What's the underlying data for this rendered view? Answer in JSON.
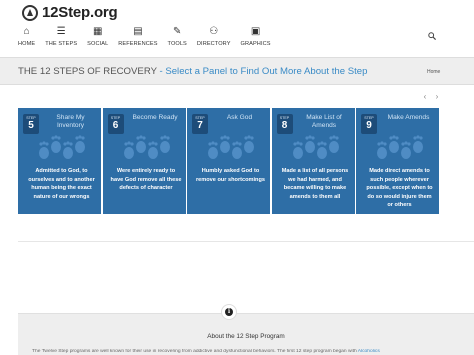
{
  "logo": {
    "text": "12Step.org"
  },
  "nav": [
    {
      "label": "HOME",
      "icon": "⌂"
    },
    {
      "label": "THE STEPS",
      "icon": "☰"
    },
    {
      "label": "SOCIAL",
      "icon": "▦"
    },
    {
      "label": "REFERENCES",
      "icon": "▤"
    },
    {
      "label": "TOOLS",
      "icon": "✎"
    },
    {
      "label": "DIRECTORY",
      "icon": "⚇"
    },
    {
      "label": "GRAPHICS",
      "icon": "▣"
    }
  ],
  "title": {
    "main": "THE 12 STEPS OF RECOVERY",
    "sub": " - Select a Panel to Find Out More About the Step",
    "home": "Home"
  },
  "carousel": {
    "prev": "‹",
    "next": "›"
  },
  "steps": [
    {
      "badge_word": "STEP",
      "number": "5",
      "title": "Share My Inventory",
      "text": "Admitted to God, to ourselves and to another human being the exact nature of our wrongs"
    },
    {
      "badge_word": "STEP",
      "number": "6",
      "title": "Become Ready",
      "text": "Were entirely ready to have God remove all these defects of character"
    },
    {
      "badge_word": "STEP",
      "number": "7",
      "title": "Ask God",
      "text": "Humbly asked God to remove our shortcomings"
    },
    {
      "badge_word": "STEP",
      "number": "8",
      "title": "Make List of Amends",
      "text": "Made a list of all persons we had harmed, and became willing to make amends to them all"
    },
    {
      "badge_word": "STEP",
      "number": "9",
      "title": "Make Amends",
      "text": "Made direct amends to such people wherever possible, except when to do so would injure them or others"
    }
  ],
  "about": {
    "icon": "i",
    "title": "About the 12 Step Program",
    "text": "The Twelve Step programs are well known for their use in recovering from addictive and dysfunctional behaviors. The first 12 step program began with ",
    "link": "Alcoholics"
  },
  "colors": {
    "panel": "#2e6ea6",
    "badge": "#1d4c79",
    "accent": "#3a8bc6"
  }
}
